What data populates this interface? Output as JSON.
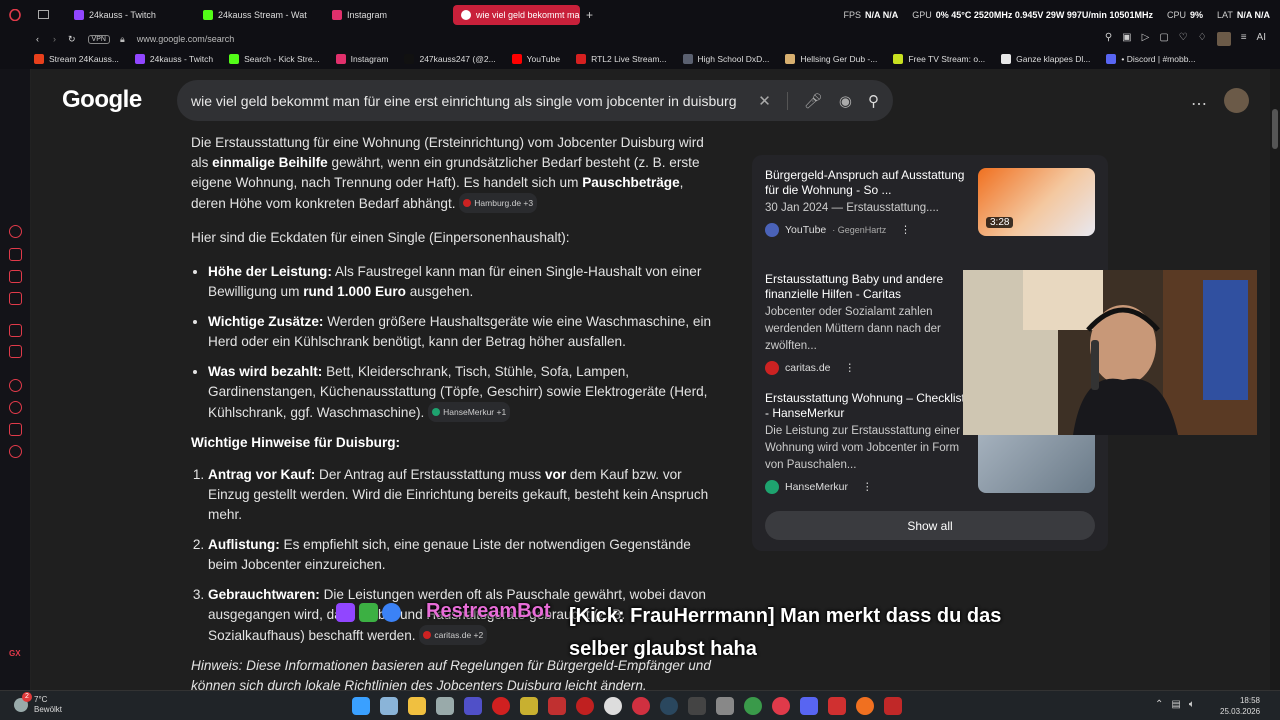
{
  "browser": {
    "tabs": [
      {
        "label": "24kauss - Twitch",
        "color": "#9146ff"
      },
      {
        "label": "24kauss Stream - Wat",
        "color": "#53fc18"
      },
      {
        "label": "Instagram",
        "color": "#e1306c"
      },
      {
        "label": "wie viel geld bekommt ma",
        "color": "#4285f4",
        "active": true
      }
    ],
    "new_tab": "+",
    "stats": [
      {
        "label": "FPS",
        "value": "N/A N/A"
      },
      {
        "label": "GPU",
        "value": "0% 45°C 2520MHz 0.945V 29W 997U/min 10501MHz"
      },
      {
        "label": "CPU",
        "value": "9%"
      },
      {
        "label": "LAT",
        "value": "N/A N/A"
      }
    ],
    "vpn": "VPN",
    "url": "www.google.com/search",
    "ai_label": "AI",
    "bookmarks": [
      {
        "label": "Stream 24Kauss...",
        "color": "#e8401c"
      },
      {
        "label": "24kauss - Twitch",
        "color": "#9146ff"
      },
      {
        "label": "Search - Kick Stre...",
        "color": "#53fc18"
      },
      {
        "label": "Instagram",
        "color": "#e1306c"
      },
      {
        "label": "247kauss247 (@2...",
        "color": "#111111"
      },
      {
        "label": "YouTube",
        "color": "#ff0000"
      },
      {
        "label": "RTL2 Live Stream...",
        "color": "#d62020"
      },
      {
        "label": "High School DxD...",
        "color": "#5a6070"
      },
      {
        "label": "Hellsing Ger Dub -...",
        "color": "#d8b070"
      },
      {
        "label": "Free TV Stream: o...",
        "color": "#c8e020"
      },
      {
        "label": "Ganze klappes Dl...",
        "color": "#e8e8e8"
      },
      {
        "label": "• Discord | #mobb...",
        "color": "#5865f2"
      }
    ]
  },
  "google": {
    "logo": "Google",
    "query": "wie viel geld bekommt man für eine erst einrichtung als single vom jobcenter in duisburg"
  },
  "answer": {
    "intro_1": "Die Erstausstattung für eine Wohnung (Ersteinrichtung) vom Jobcenter Duisburg wird als ",
    "intro_b1": "einmalige Beihilfe",
    "intro_2": " gewährt, wenn ein grundsätzlicher Bedarf besteht (z. B. erste eigene Wohnung, nach Trennung oder Haft). Es handelt sich um ",
    "intro_b2": "Pauschbeträge",
    "intro_3": ", deren Höhe vom konkreten Bedarf abhängt.",
    "cite1": "Hamburg.de +3",
    "subhead": "Hier sind die Eckdaten für einen Single (Einpersonenhaushalt):",
    "bullets": [
      {
        "bold": "Höhe der Leistung:",
        "text": " Als Faustregel kann man für einen Single-Haushalt von einer Bewilligung um ",
        "bold2": "rund 1.000 Euro",
        "text2": " ausgehen."
      },
      {
        "bold": "Wichtige Zusätze:",
        "text": " Werden größere Haushaltsgeräte wie eine Waschmaschine, ein Herd oder ein Kühlschrank benötigt, kann der Betrag höher ausfallen."
      },
      {
        "bold": "Was wird bezahlt:",
        "text": " Bett, Kleiderschrank, Tisch, Stühle, Sofa, Lampen, Gardinenstangen, Küchenausstattung (Töpfe, Geschirr) sowie Elektrogeräte (Herd, Kühlschrank, ggf. Waschmaschine).",
        "cite": "HanseMerkur +1"
      }
    ],
    "heading2": "Wichtige Hinweise für Duisburg:",
    "numbered": [
      {
        "bold": "Antrag vor Kauf:",
        "text": " Der Antrag auf Erstausstattung muss ",
        "bold2": "vor",
        "text2": " dem Kauf bzw. vor Einzug gestellt werden. Wird die Einrichtung bereits gekauft, besteht kein Anspruch mehr."
      },
      {
        "bold": "Auflistung:",
        "text": " Es empfiehlt sich, eine genaue Liste der notwendigen Gegenstände beim Jobcenter einzureichen."
      },
      {
        "bold": "Gebrauchtwaren:",
        "text": " Die Leistungen werden oft als Pauschale gewährt, wobei davon ausgegangen wird, dass Möbel und Haushaltsgeräte gebraucht (z. B. Sozialkaufhaus) beschafft werden.",
        "cite": "caritas.de +2"
      }
    ],
    "hinweis": "Hinweis: Diese Informationen basieren auf Regelungen für Bürgergeld-Empfänger und können sich durch lokale Richtlinien des Jobcenters Duisburg leicht ändern."
  },
  "sources": {
    "cards": [
      {
        "title": "Bürgergeld-Anspruch auf Ausstattung für die Wohnung - So ...",
        "snippet": "30 Jan 2024 — Erstausstattung....",
        "source": "YouTube",
        "author": "· GegenHartz",
        "duration": "3:28"
      },
      {
        "title": "Erstausstattung Baby und andere finanzielle Hilfen - Caritas",
        "snippet": "Jobcenter oder Sozialamt zahlen werdenden Müttern dann nach der zwölften...",
        "source": "caritas.de"
      },
      {
        "title": "Erstausstattung Wohnung – Checkliste - HanseMerkur",
        "snippet": "Die Leistung zur Erstausstattung einer Wohnung wird vom Jobcenter in Form von Pauschalen...",
        "source": "HanseMerkur"
      }
    ],
    "show_all": "Show all"
  },
  "overlay": {
    "bot": "RestreamBot",
    "message": "[Kick: FrauHerrmann] Man merkt dass du das selber glaubst haha"
  },
  "taskbar": {
    "notif_count": "2",
    "temp": "7°C",
    "weather": "Bewölkt",
    "time": "18:58",
    "date": "25.03.2026"
  }
}
